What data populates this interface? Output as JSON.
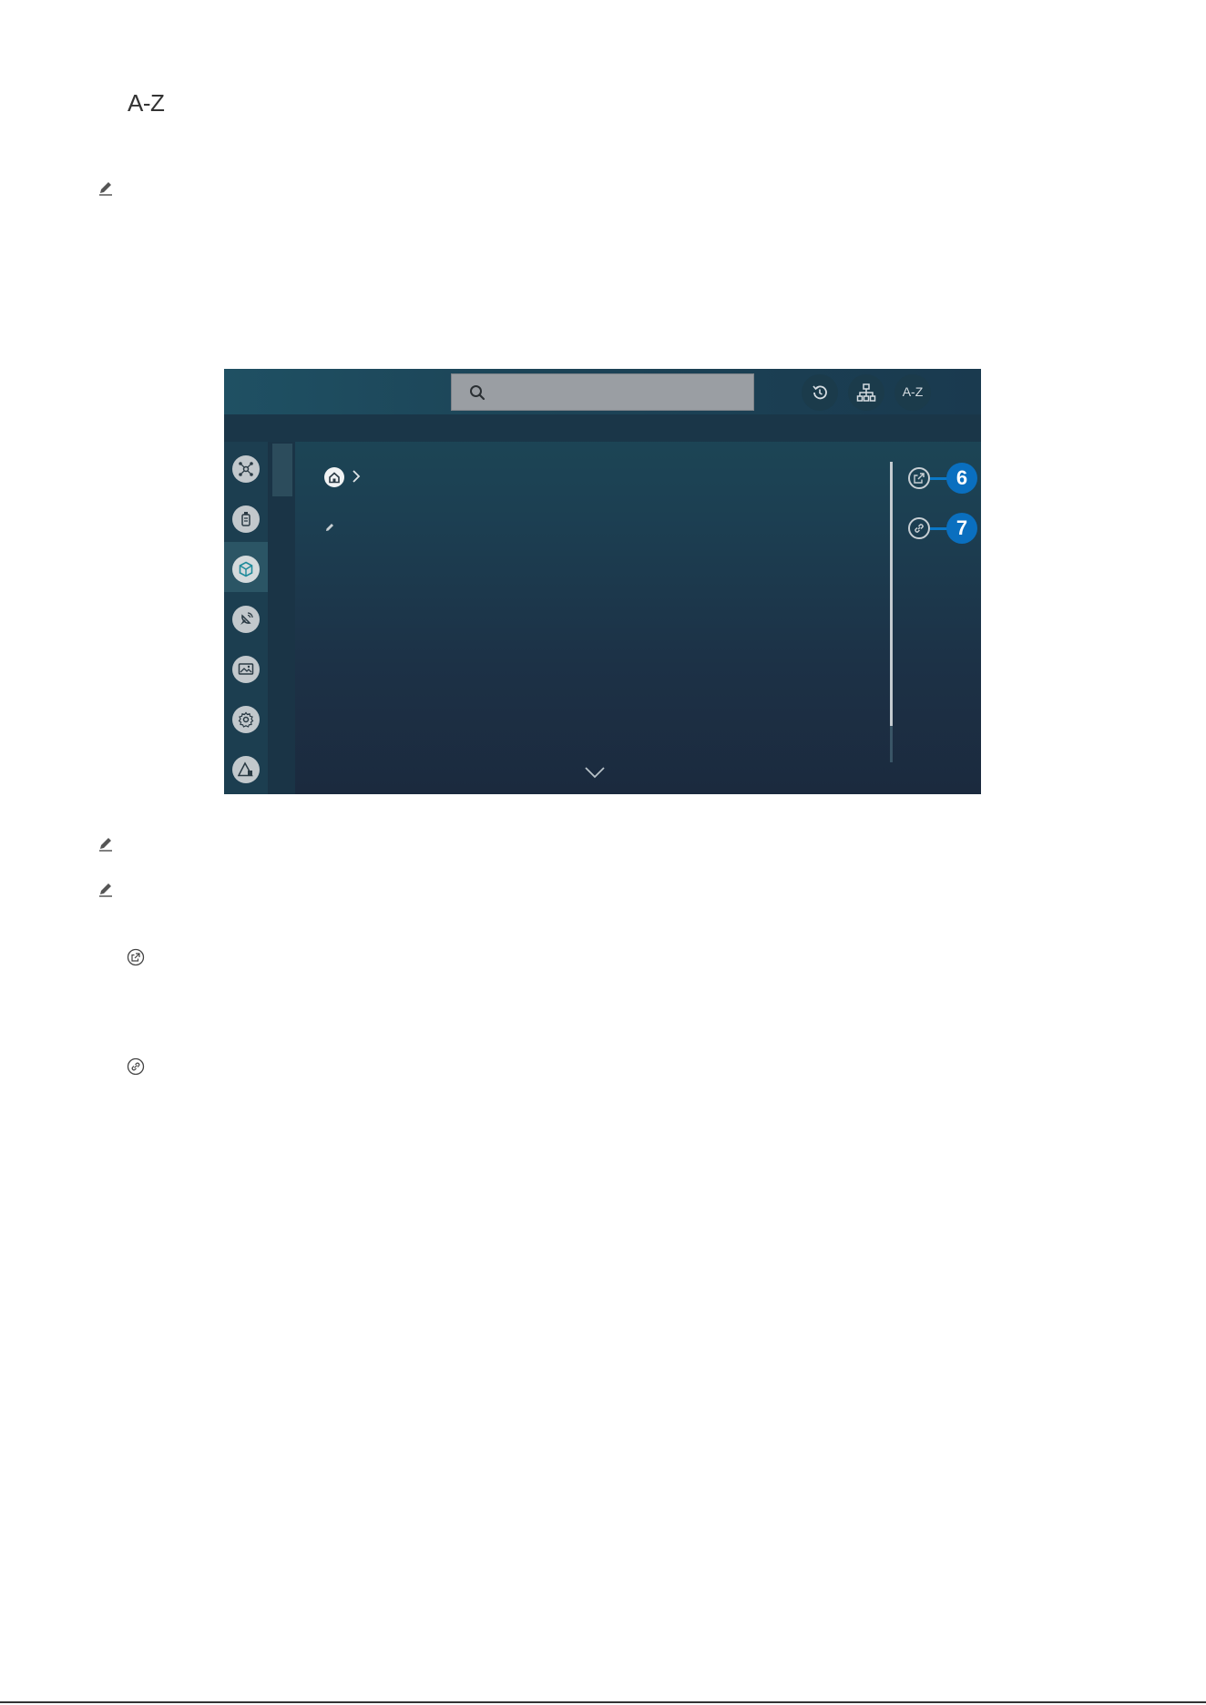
{
  "heading": {
    "az_label": "A-Z"
  },
  "tv": {
    "topbar": {
      "az_button_label": "A-Z"
    },
    "sidebar": {
      "items": [
        {
          "icon": "connected-devices-icon"
        },
        {
          "icon": "source-icon"
        },
        {
          "icon": "smart-hub-icon",
          "selected": true
        },
        {
          "icon": "broadcast-icon"
        },
        {
          "icon": "picture-icon"
        },
        {
          "icon": "settings-icon"
        },
        {
          "icon": "troubleshooting-icon"
        }
      ]
    },
    "actions": [
      {
        "icon": "open-external-icon",
        "badge": "6"
      },
      {
        "icon": "link-icon",
        "badge": "7"
      }
    ]
  }
}
